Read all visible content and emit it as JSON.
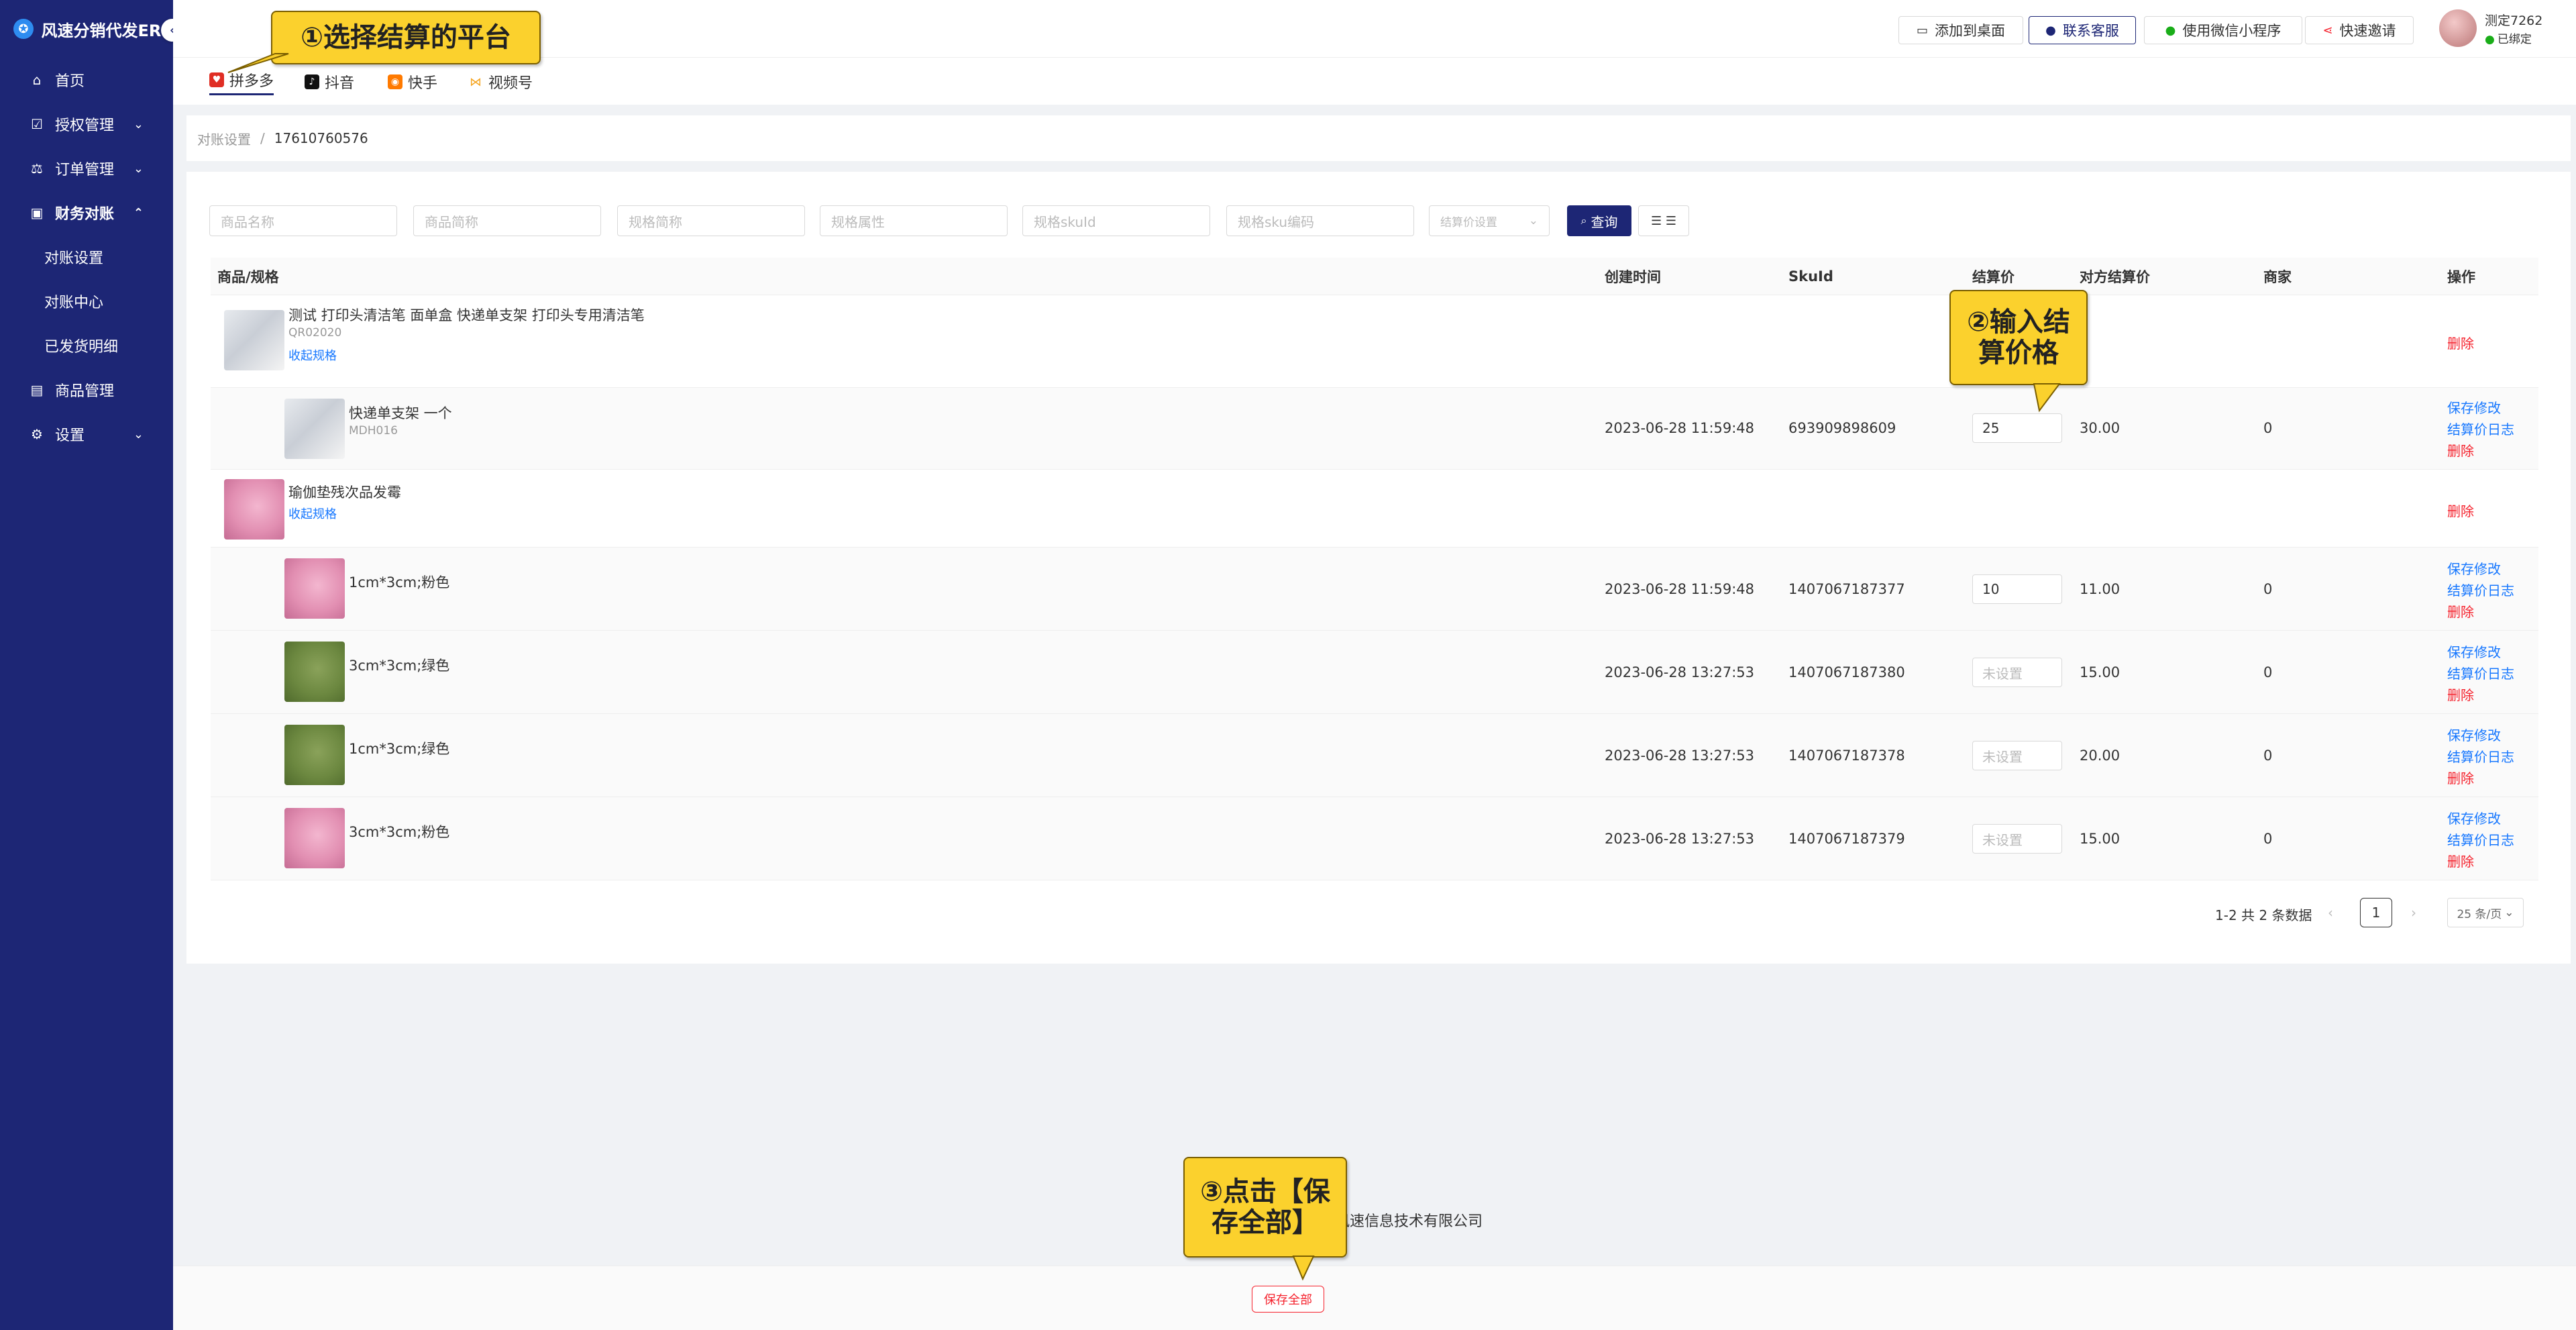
{
  "app": {
    "brand": "风速分销代发ERP"
  },
  "sidebar": {
    "items": [
      {
        "label": "首页",
        "icon": "home-icon",
        "glyph": "⌂"
      },
      {
        "label": "授权管理",
        "icon": "auth-icon",
        "glyph": "☑"
      },
      {
        "label": "订单管理",
        "icon": "order-icon",
        "glyph": "⚖"
      },
      {
        "label": "财务对账",
        "icon": "finance-icon",
        "glyph": "▣"
      },
      {
        "label": "商品管理",
        "icon": "product-icon",
        "glyph": "▤"
      },
      {
        "label": "设置",
        "icon": "settings-icon",
        "glyph": "⚙"
      }
    ],
    "sub_items": [
      "对账设置",
      "对账中心",
      "已发货明细"
    ]
  },
  "header": {
    "buttons": [
      "添加到桌面",
      "联系客服",
      "使用微信小程序",
      "快速邀请"
    ],
    "user_name": "测定7262",
    "user_status": "已绑定"
  },
  "tabs": [
    "拼多多",
    "抖音",
    "快手",
    "视频号"
  ],
  "breadcrumb": {
    "parent": "对账设置",
    "current": "17610760576"
  },
  "filters": {
    "placeholders": [
      "商品名称",
      "商品简称",
      "规格简称",
      "规格属性",
      "规格skuId",
      "规格sku编码"
    ],
    "select_placeholder": "结算价设置",
    "query_label": "查询",
    "columns_label": "☰ ☰"
  },
  "table": {
    "headers": [
      "商品/规格",
      "创建时间",
      "SkuId",
      "结算价",
      "对方结算价",
      "商家",
      "操作"
    ],
    "rows": [
      {
        "type": "parent",
        "name": "测试 打印头清洁笔 面单盒 快递单支架 打印头专用清洁笔",
        "code": "QR02020",
        "link": "收起规格",
        "delete": "删除"
      },
      {
        "type": "child",
        "name": "快递单支架 一个",
        "code": "MDH016",
        "created": "2023-06-28 11:59:48",
        "skuid": "693909898609",
        "price": "25",
        "other_price": "30.00",
        "merchant": "0",
        "save": "保存修改",
        "log": "结算价日志",
        "delete": "删除"
      },
      {
        "type": "parent",
        "name": "瑜伽垫残次品发霉",
        "link": "收起规格",
        "delete": "删除"
      },
      {
        "type": "child",
        "name": "1cm*3cm;粉色",
        "created": "2023-06-28 11:59:48",
        "skuid": "1407067187377",
        "price": "10",
        "other_price": "11.00",
        "merchant": "0",
        "save": "保存修改",
        "log": "结算价日志",
        "delete": "删除"
      },
      {
        "type": "child",
        "name": "3cm*3cm;绿色",
        "created": "2023-06-28 13:27:53",
        "skuid": "1407067187380",
        "price_placeholder": "未设置",
        "other_price": "15.00",
        "merchant": "0",
        "save": "保存修改",
        "log": "结算价日志",
        "delete": "删除"
      },
      {
        "type": "child",
        "name": "1cm*3cm;绿色",
        "created": "2023-06-28 13:27:53",
        "skuid": "1407067187378",
        "price_placeholder": "未设置",
        "other_price": "20.00",
        "merchant": "0",
        "save": "保存修改",
        "log": "结算价日志",
        "delete": "删除"
      },
      {
        "type": "child",
        "name": "3cm*3cm;粉色",
        "created": "2023-06-28 13:27:53",
        "skuid": "1407067187379",
        "price_placeholder": "未设置",
        "other_price": "15.00",
        "merchant": "0",
        "save": "保存修改",
        "log": "结算价日志",
        "delete": "删除"
      }
    ]
  },
  "pagination": {
    "total": "1-2 共 2 条数据",
    "page": "1",
    "size": "25 条/页"
  },
  "footer": {
    "company": "风速信息技术有限公司",
    "save_all": "保存全部"
  },
  "callouts": {
    "step1": "①选择结算的平台",
    "step2": "②输入结算价格",
    "step3": "③点击【保存全部】"
  },
  "colors": {
    "sidebar_bg": "#1d2675",
    "callout": "#fbd12d",
    "link": "#1677ff",
    "danger": "#f5222d"
  }
}
